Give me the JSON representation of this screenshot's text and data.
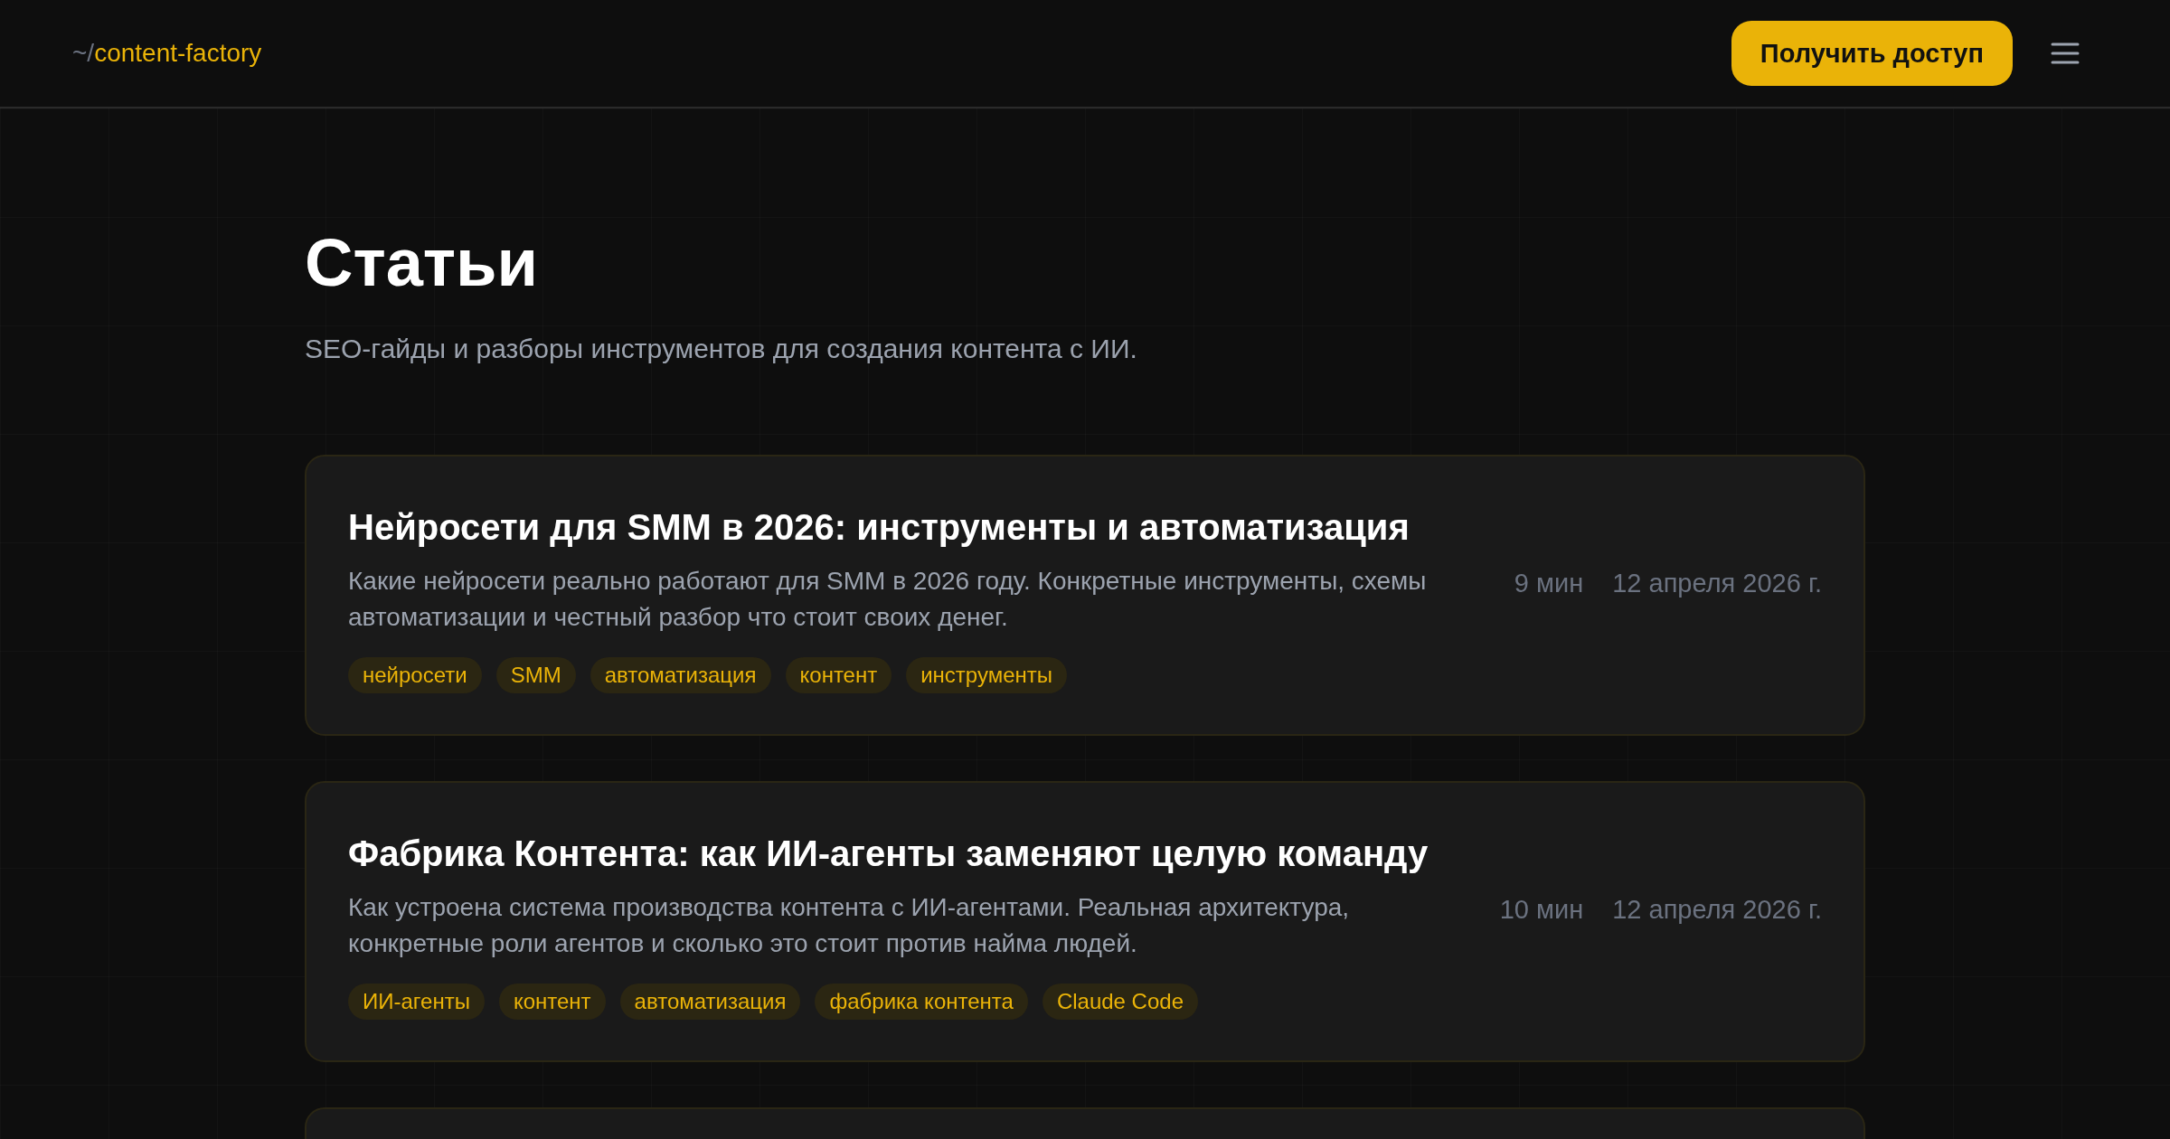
{
  "header": {
    "logo": {
      "prefix": "~/",
      "name": "content-factory"
    },
    "cta": "Получить доступ"
  },
  "page": {
    "title": "Статьи",
    "subtitle": "SEO-гайды и разборы инструментов для создания контента с ИИ."
  },
  "articles": [
    {
      "title": "Нейросети для SMM в 2026: инструменты и автоматизация",
      "description": "Какие нейросети реально работают для SMM в 2026 году. Конкретные инструменты, схемы автоматизации и честный разбор что стоит своих денег.",
      "read_time": "9 мин",
      "date": "12 апреля 2026 г.",
      "tags": [
        "нейросети",
        "SMM",
        "автоматизация",
        "контент",
        "инструменты"
      ]
    },
    {
      "title": "Фабрика Контента: как ИИ-агенты заменяют целую команду",
      "description": "Как устроена система производства контента с ИИ-агентами. Реальная архитектура, конкретные роли агентов и сколько это стоит против найма людей.",
      "read_time": "10 мин",
      "date": "12 апреля 2026 г.",
      "tags": [
        "ИИ-агенты",
        "контент",
        "автоматизация",
        "фабрика контента",
        "Claude Code"
      ]
    }
  ]
}
